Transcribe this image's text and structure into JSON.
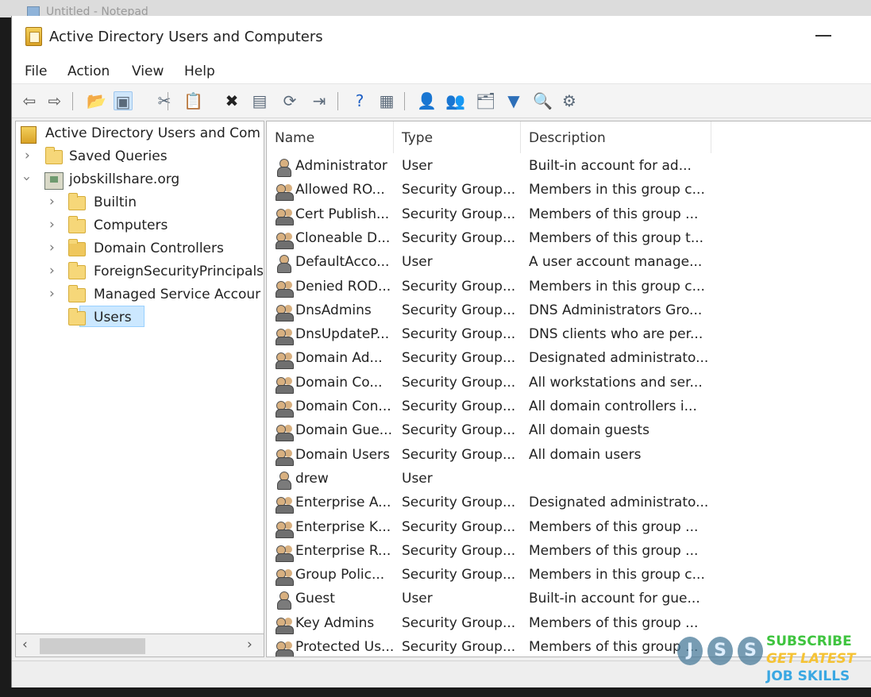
{
  "behind_window": {
    "title": "Untitled - Notepad"
  },
  "window": {
    "title": "Active Directory Users and Computers"
  },
  "menu": [
    "File",
    "Action",
    "View",
    "Help"
  ],
  "toolbar": [
    {
      "name": "back-icon",
      "glyph": "⇦"
    },
    {
      "name": "forward-icon",
      "glyph": "⇨"
    },
    {
      "name": "up-folder-icon",
      "glyph": "📂"
    },
    {
      "name": "show-console-tree-icon",
      "glyph": "▣"
    },
    {
      "name": "cut-icon",
      "glyph": "✂"
    },
    {
      "name": "copy-icon",
      "glyph": "📋"
    },
    {
      "name": "delete-icon",
      "glyph": "✖"
    },
    {
      "name": "properties-icon",
      "glyph": "▤"
    },
    {
      "name": "refresh-icon",
      "glyph": "⟳"
    },
    {
      "name": "export-list-icon",
      "glyph": "⇥"
    },
    {
      "name": "help-icon",
      "glyph": "?"
    },
    {
      "name": "action-pane-icon",
      "glyph": "▦"
    },
    {
      "name": "create-user-icon",
      "glyph": "👤"
    },
    {
      "name": "create-group-icon",
      "glyph": "👥"
    },
    {
      "name": "create-ou-icon",
      "glyph": "🗂"
    },
    {
      "name": "filter-icon",
      "glyph": "▼"
    },
    {
      "name": "find-icon",
      "glyph": "🔍"
    },
    {
      "name": "add-to-group-icon",
      "glyph": "⚙"
    }
  ],
  "tree": {
    "root": "Active Directory Users and Com",
    "saved_queries": "Saved Queries",
    "domain": "jobskillshare.org",
    "children": [
      "Builtin",
      "Computers",
      "Domain Controllers",
      "ForeignSecurityPrincipals",
      "Managed Service Accour",
      "Users"
    ],
    "selected": "Users"
  },
  "columns": {
    "name": "Name",
    "type": "Type",
    "description": "Description"
  },
  "rows": [
    {
      "name": "Administrator",
      "type": "User",
      "description": "Built-in account for ad...",
      "kind": "user"
    },
    {
      "name": "Allowed RO...",
      "type": "Security Group...",
      "description": "Members in this group c...",
      "kind": "group"
    },
    {
      "name": "Cert Publish...",
      "type": "Security Group...",
      "description": "Members of this group ...",
      "kind": "group"
    },
    {
      "name": "Cloneable D...",
      "type": "Security Group...",
      "description": "Members of this group t...",
      "kind": "group"
    },
    {
      "name": "DefaultAcco...",
      "type": "User",
      "description": "A user account manage...",
      "kind": "user-disabled"
    },
    {
      "name": "Denied ROD...",
      "type": "Security Group...",
      "description": "Members in this group c...",
      "kind": "group"
    },
    {
      "name": "DnsAdmins",
      "type": "Security Group...",
      "description": "DNS Administrators Gro...",
      "kind": "group"
    },
    {
      "name": "DnsUpdateP...",
      "type": "Security Group...",
      "description": "DNS clients who are per...",
      "kind": "group"
    },
    {
      "name": "Domain Ad...",
      "type": "Security Group...",
      "description": "Designated administrato...",
      "kind": "group"
    },
    {
      "name": "Domain Co...",
      "type": "Security Group...",
      "description": "All workstations and ser...",
      "kind": "group"
    },
    {
      "name": "Domain Con...",
      "type": "Security Group...",
      "description": "All domain controllers i...",
      "kind": "group"
    },
    {
      "name": "Domain Gue...",
      "type": "Security Group...",
      "description": "All domain guests",
      "kind": "group"
    },
    {
      "name": "Domain Users",
      "type": "Security Group...",
      "description": "All domain users",
      "kind": "group"
    },
    {
      "name": "drew",
      "type": "User",
      "description": "",
      "kind": "user"
    },
    {
      "name": "Enterprise A...",
      "type": "Security Group...",
      "description": "Designated administrato...",
      "kind": "group"
    },
    {
      "name": "Enterprise K...",
      "type": "Security Group...",
      "description": "Members of this group ...",
      "kind": "group"
    },
    {
      "name": "Enterprise R...",
      "type": "Security Group...",
      "description": "Members of this group ...",
      "kind": "group"
    },
    {
      "name": "Group Polic...",
      "type": "Security Group...",
      "description": "Members in this group c...",
      "kind": "group"
    },
    {
      "name": "Guest",
      "type": "User",
      "description": "Built-in account for gue...",
      "kind": "user-disabled"
    },
    {
      "name": "Key Admins",
      "type": "Security Group...",
      "description": "Members of this group ...",
      "kind": "group"
    },
    {
      "name": "Protected Us...",
      "type": "Security Group...",
      "description": "Members of this group ...",
      "kind": "group"
    }
  ],
  "watermark": {
    "letters": [
      "J",
      "S",
      "S"
    ],
    "line1": "SUBSCRIBE",
    "line2": "GET LATEST",
    "line3": "JOB SKILLS"
  }
}
